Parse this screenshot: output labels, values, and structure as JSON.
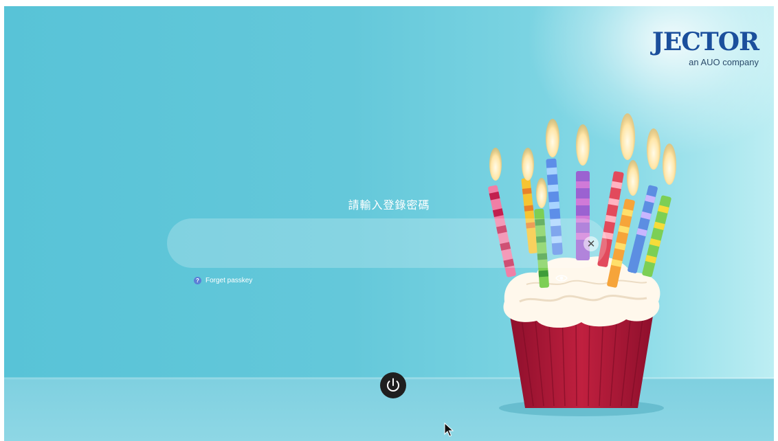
{
  "branding": {
    "logo_text": "JECTOR",
    "tagline": "an AUO company"
  },
  "login": {
    "prompt": "請輸入登錄密碼",
    "password_value": "",
    "forget_label": "Forget passkey",
    "clear_icon": "close-icon",
    "reveal_icon": "eye-icon"
  },
  "system": {
    "power_icon": "power-icon"
  },
  "colors": {
    "background": "#64c8da",
    "logo_blue": "#1b4f9c",
    "power_button": "#1f1f1f",
    "cupcake_liner": "#b3183a"
  }
}
